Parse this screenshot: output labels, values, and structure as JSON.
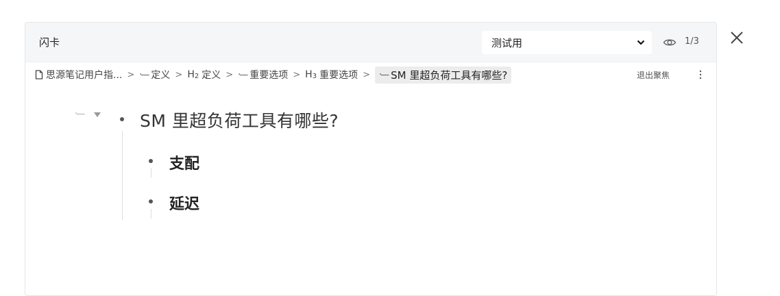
{
  "window": {
    "title": "闪卡",
    "deck_select": "测试用",
    "counter": "1/3",
    "close_icon": "close-icon"
  },
  "breadcrumb": {
    "items": [
      {
        "label": "思源笔记用户指..."
      },
      {
        "label": "定义"
      },
      {
        "label": "定义",
        "heading": "H",
        "level": "2"
      },
      {
        "label": "重要选项"
      },
      {
        "label": "重要选项",
        "heading": "H",
        "level": "3"
      },
      {
        "label": "SM 里超负荷工具有哪些?"
      }
    ],
    "exit_focus": "退出聚焦"
  },
  "card": {
    "question": "SM 里超负荷工具有哪些?",
    "answers": [
      "支配",
      "延迟"
    ]
  },
  "colors": {
    "topbar_bg": "#f5f6f7",
    "current_crumb_bg": "#ececec"
  }
}
